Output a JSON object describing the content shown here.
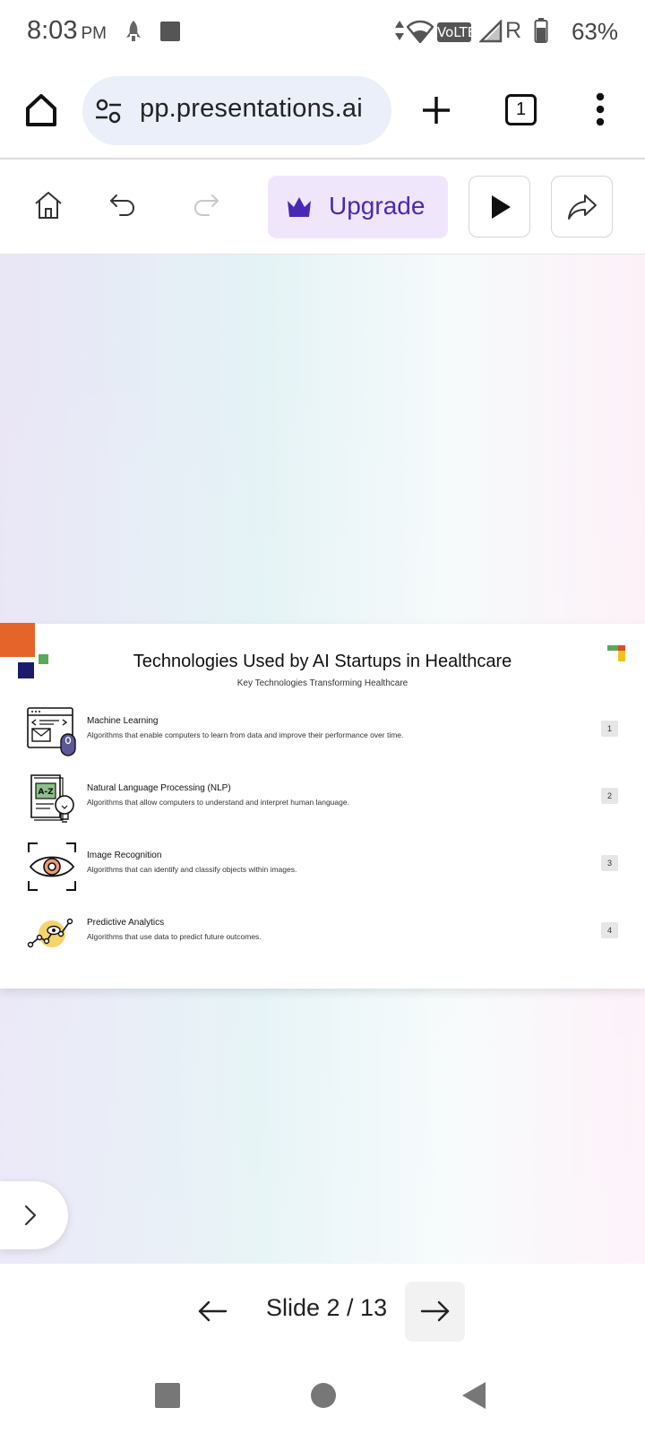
{
  "status_bar": {
    "time": "8:03",
    "ampm": "PM",
    "network": "VoLTE",
    "roaming": "R",
    "battery": "63%"
  },
  "browser": {
    "url": "app.presentations.ai",
    "url_display": "pp.presentations.ai",
    "tab_count": "1",
    "icons": [
      "home-icon",
      "site-settings-icon",
      "new-tab-icon",
      "tab-switcher-icon",
      "overflow-menu-icon"
    ]
  },
  "toolbar": {
    "upgrade_label": "Upgrade",
    "icons": [
      "home-icon",
      "undo-icon",
      "redo-icon",
      "crown-icon",
      "play-icon",
      "share-icon"
    ]
  },
  "slide": {
    "title": "Technologies Used by AI Startups in Healthcare",
    "subtitle": "Key Technologies Transforming Healthcare",
    "items": [
      {
        "name": "Machine Learning",
        "description": "Algorithms that enable computers to learn from data and improve their performance over time.",
        "number": "1",
        "icon": "machine-learning-icon"
      },
      {
        "name": "Natural Language Processing (NLP)",
        "description": "Algorithms that allow computers to understand and interpret human language.",
        "number": "2",
        "icon": "nlp-icon",
        "icon_text": "A-Z"
      },
      {
        "name": "Image Recognition",
        "description": "Algorithms that can identify and classify objects within images.",
        "number": "3",
        "icon": "eye-scan-icon"
      },
      {
        "name": "Predictive Analytics",
        "description": "Algorithms that use data to predict future outcomes.",
        "number": "4",
        "icon": "analytics-icon"
      }
    ]
  },
  "navigation": {
    "counter": "Slide 2 / 13"
  },
  "colors": {
    "accent_purple": "#4b27b5",
    "upgrade_bg": "#f0e6fb",
    "deco_orange": "#e4642a",
    "deco_navy": "#1e1a6b",
    "deco_green": "#5aa85c",
    "deco_yellow": "#f3c11d",
    "deco_red": "#d94b2a"
  }
}
